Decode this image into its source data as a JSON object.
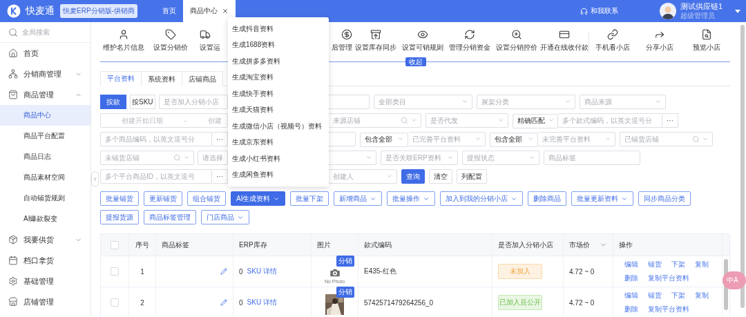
{
  "header": {
    "app_name": "快麦通",
    "edition_badge": "快麦ERP分销版-供销商",
    "tabs": [
      {
        "label": "首页",
        "selected": false,
        "closable": false
      },
      {
        "label": "商品中心",
        "selected": true,
        "closable": true
      }
    ],
    "contact": "和我联系",
    "user": {
      "name": "测试供应链1",
      "role": "超级管理员"
    }
  },
  "sidebar": {
    "search": {
      "placeholder": "全局搜索"
    },
    "items": [
      {
        "label": "首页"
      },
      {
        "label": "分销商管理",
        "expanded": false
      },
      {
        "label": "商品管理",
        "expanded": true,
        "children": [
          {
            "label": "商品中心",
            "selected": true
          },
          {
            "label": "商品平台配置",
            "selected": false
          },
          {
            "label": "商品日志",
            "selected": false
          },
          {
            "label": "商品素材空间",
            "selected": false
          },
          {
            "label": "自动铺货规则",
            "selected": false
          },
          {
            "label": "AI爆款裂变",
            "selected": false
          }
        ]
      },
      {
        "label": "我要供货",
        "expanded": false
      },
      {
        "label": "档口拿货"
      },
      {
        "label": "基础管理"
      },
      {
        "label": "店铺管理"
      }
    ]
  },
  "toolbar": {
    "items": [
      {
        "label": "维护名片信息",
        "kind": "full"
      },
      {
        "label": "设置分销价",
        "kind": "full"
      },
      {
        "label": "设置运",
        "kind": "lead"
      },
      {
        "label": "后管理",
        "kind": "tail"
      },
      {
        "label": "设置库存同步",
        "kind": "full"
      },
      {
        "label": "设置可销规则",
        "kind": "full"
      },
      {
        "label": "管理分销资金",
        "kind": "full"
      },
      {
        "label": "设置分销控价",
        "kind": "full"
      },
      {
        "label": "开通在线收付款",
        "kind": "full"
      },
      {
        "label": "手机看小店",
        "kind": "full",
        "divider_before": true
      },
      {
        "label": "分享小店",
        "kind": "full"
      },
      {
        "label": "预览小店",
        "kind": "full"
      }
    ],
    "collapse_label": "收起"
  },
  "data_tabs": [
    {
      "label": "平台资料",
      "selected": true
    },
    {
      "label": "系统资料",
      "selected": false
    },
    {
      "label": "店铺商品",
      "selected": false
    }
  ],
  "filter_rows": [
    {
      "left": [
        {
          "kind": "segmented",
          "options": [
            {
              "label": "按款",
              "selected": true
            },
            {
              "label": "按SKU",
              "selected": false
            }
          ]
        },
        {
          "kind": "input",
          "placeholder": "是否加入分销小店"
        }
      ],
      "right": [
        {
          "kind": "input"
        },
        {
          "kind": "select",
          "placeholder": "全部类目"
        },
        {
          "kind": "select",
          "placeholder": "展架分类"
        },
        {
          "kind": "select",
          "placeholder": "商品来源"
        }
      ]
    },
    {
      "left": [
        {
          "kind": "date-range",
          "start_placeholder": "创建开始日期",
          "separator": "-",
          "end_placeholder": "创建"
        }
      ],
      "right": [
        {
          "kind": "search-select",
          "placeholder": "来源店铺"
        },
        {
          "kind": "select",
          "placeholder": "是否代发"
        },
        {
          "kind": "match-input",
          "mode": "精确匹配",
          "placeholder": "多个款式编码，以英文逗号分",
          "more": "···"
        }
      ]
    },
    {
      "left": [
        {
          "kind": "input-more",
          "placeholder": "多个商品编码，以英文逗号分",
          "more": "···"
        }
      ],
      "right": [
        {
          "kind": "input"
        },
        {
          "kind": "prefixed",
          "prefix": "包含全部",
          "placeholder": "已完善平台资料"
        },
        {
          "kind": "prefixed",
          "prefix": "包含全部",
          "placeholder": "未完善平台资料"
        },
        {
          "kind": "search-select",
          "placeholder": "已铺货店铺"
        }
      ]
    },
    {
      "left": [
        {
          "kind": "search-select",
          "placeholder": "未铺货店铺"
        },
        {
          "kind": "input",
          "placeholder": "请选择"
        }
      ],
      "right": [
        {
          "kind": "select"
        },
        {
          "kind": "select",
          "placeholder": "是否关联ERP资料"
        },
        {
          "kind": "select",
          "placeholder": "提报状态"
        },
        {
          "kind": "input",
          "placeholder": "商品标签"
        }
      ]
    },
    {
      "left": [
        {
          "kind": "input-more",
          "placeholder": "多个平台商品ID，以英文逗号",
          "more": "···"
        }
      ],
      "right": [
        {
          "kind": "select",
          "placeholder": "创建人"
        },
        {
          "kind": "button",
          "label": "查询",
          "primary": true
        },
        {
          "kind": "button",
          "label": "清空",
          "primary": false
        },
        {
          "kind": "button",
          "label": "列配置",
          "primary": false
        }
      ]
    }
  ],
  "actions": [
    {
      "label": "批量铺货",
      "primary": false,
      "menu": false
    },
    {
      "label": "更新铺货",
      "primary": false,
      "menu": false
    },
    {
      "label": "组合铺货",
      "primary": false,
      "menu": false
    },
    {
      "label": "AI生成资料",
      "primary": true,
      "menu": true
    },
    {
      "label": "批量下架",
      "primary": false,
      "menu": false
    },
    {
      "label": "新增商品",
      "primary": false,
      "menu": true
    },
    {
      "label": "批量操作",
      "primary": false,
      "menu": true
    },
    {
      "label": "加入到我的分销小店",
      "primary": false,
      "menu": true
    },
    {
      "label": "删除商品",
      "primary": false,
      "menu": false
    },
    {
      "label": "批量更新资料",
      "primary": false,
      "menu": true
    },
    {
      "label": "同步商品分类",
      "primary": false,
      "menu": false
    },
    {
      "label": "提报货源",
      "primary": false,
      "menu": false
    },
    {
      "label": "商品标签管理",
      "primary": false,
      "menu": false
    },
    {
      "label": "门店商品",
      "primary": false,
      "menu": true
    }
  ],
  "ai_menu": {
    "items": [
      "生成抖音资料",
      "生成1688资料",
      "生成拼多多资料",
      "生成淘宝资料",
      "生成快手资料",
      "生成天猫资料",
      "生成微信小店（视频号）资料",
      "生成京东资料",
      "生成小红书资料",
      "生成闲鱼资料"
    ]
  },
  "table": {
    "columns": [
      {
        "kind": "checkbox",
        "checked": false
      },
      {
        "kind": "text",
        "label": "序号"
      },
      {
        "kind": "text",
        "label": "商品标签"
      },
      {
        "kind": "text",
        "label": "ERP库存"
      },
      {
        "kind": "text",
        "label": "图片"
      },
      {
        "kind": "text",
        "label": "款式编码"
      },
      {
        "kind": "text",
        "label": "是否加入分销小店"
      },
      {
        "kind": "filter",
        "label": "市场价"
      },
      {
        "kind": "text",
        "label": "操作"
      }
    ],
    "rows": [
      {
        "checked": false,
        "index": "1",
        "stock": "0",
        "sku_link": "SKU 详情",
        "photo": {
          "kind": "none",
          "text": "No Photo",
          "badge": "分销"
        },
        "style_code": "E435-红色",
        "status": {
          "label": "未加入",
          "kind": "warning"
        },
        "price": "4.72 ~ 0",
        "actions": [
          "编辑",
          "铺货",
          "下架",
          "复制",
          "删除",
          "复制平台资料"
        ]
      },
      {
        "checked": false,
        "index": "2",
        "stock": "0",
        "sku_link": "SKU 详情",
        "photo": {
          "kind": "picture",
          "badge": "分销"
        },
        "style_code": "5742571479264256_0",
        "status": {
          "label": "已加入且公开",
          "kind": "success"
        },
        "price": "4.72 ~ 0",
        "actions": [
          "编辑",
          "铺货",
          "下架",
          "复制",
          "删除",
          "复制平台资料"
        ]
      }
    ]
  },
  "translate_button": "中A"
}
